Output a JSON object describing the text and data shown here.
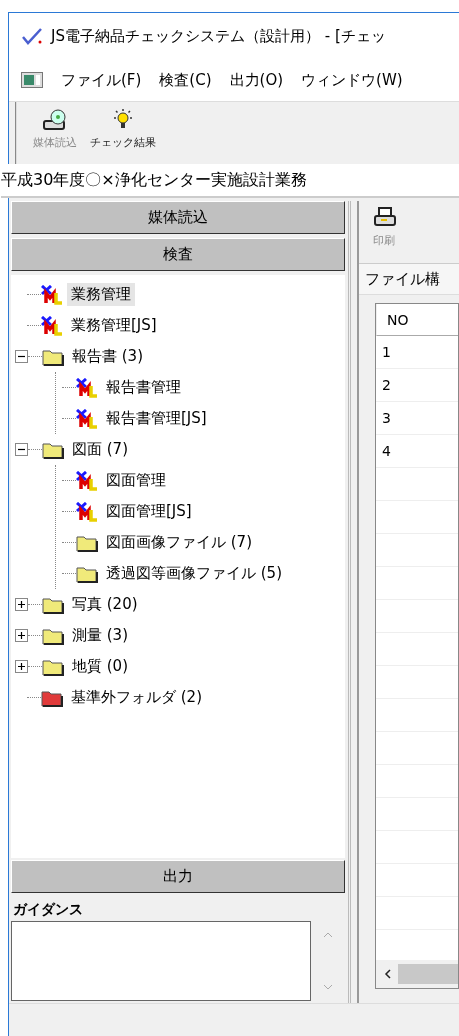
{
  "window": {
    "title": "JS電子納品チェックシステム（設計用） - [チェッ"
  },
  "menu": [
    "ファイル(F)",
    "検査(C)",
    "出力(O)",
    "ウィンドウ(W)"
  ],
  "toolbar": [
    {
      "kind": "disc",
      "label": "媒体読込",
      "disabled": true
    },
    {
      "kind": "bulb",
      "label": "チェック結果",
      "disabled": false
    }
  ],
  "project_title": "平成30年度〇×浄化センター実施設計業務",
  "left_panel": {
    "buttons_top": [
      "媒体読込",
      "検査"
    ],
    "tree": [
      {
        "kind": "doc",
        "label": "業務管理",
        "selected": true
      },
      {
        "kind": "doc",
        "label": "業務管理[JS]",
        "selected": false
      },
      {
        "kind": "folder",
        "label": "報告書 (3)",
        "selected": false,
        "expanded": true,
        "children": [
          {
            "kind": "doc",
            "label": "報告書管理",
            "selected": false
          },
          {
            "kind": "doc",
            "label": "報告書管理[JS]",
            "selected": false
          }
        ]
      },
      {
        "kind": "folder",
        "label": "図面 (7)",
        "selected": false,
        "expanded": true,
        "children": [
          {
            "kind": "doc",
            "label": "図面管理",
            "selected": false
          },
          {
            "kind": "doc",
            "label": "図面管理[JS]",
            "selected": false
          },
          {
            "kind": "folder",
            "label": "図面画像ファイル (7)",
            "selected": false
          },
          {
            "kind": "folder",
            "label": "透過図等画像ファイル (5)",
            "selected": false
          }
        ]
      },
      {
        "kind": "folder",
        "label": "写真 (20)",
        "selected": false,
        "expanded": false
      },
      {
        "kind": "folder",
        "label": "測量 (3)",
        "selected": false,
        "expanded": false
      },
      {
        "kind": "folder",
        "label": "地質 (0)",
        "selected": false,
        "expanded": false
      },
      {
        "kind": "excluded",
        "label": "基準外フォルダ (2)",
        "selected": false
      }
    ],
    "button_bottom": "出力",
    "guidance_label": "ガイダンス"
  },
  "right_panel": {
    "toolbar": [
      {
        "label": "印刷",
        "disabled": true
      }
    ],
    "tab": "ファイル構",
    "table": {
      "columns": [
        "NO"
      ],
      "rows": [
        "1",
        "2",
        "3",
        "4"
      ]
    }
  }
}
